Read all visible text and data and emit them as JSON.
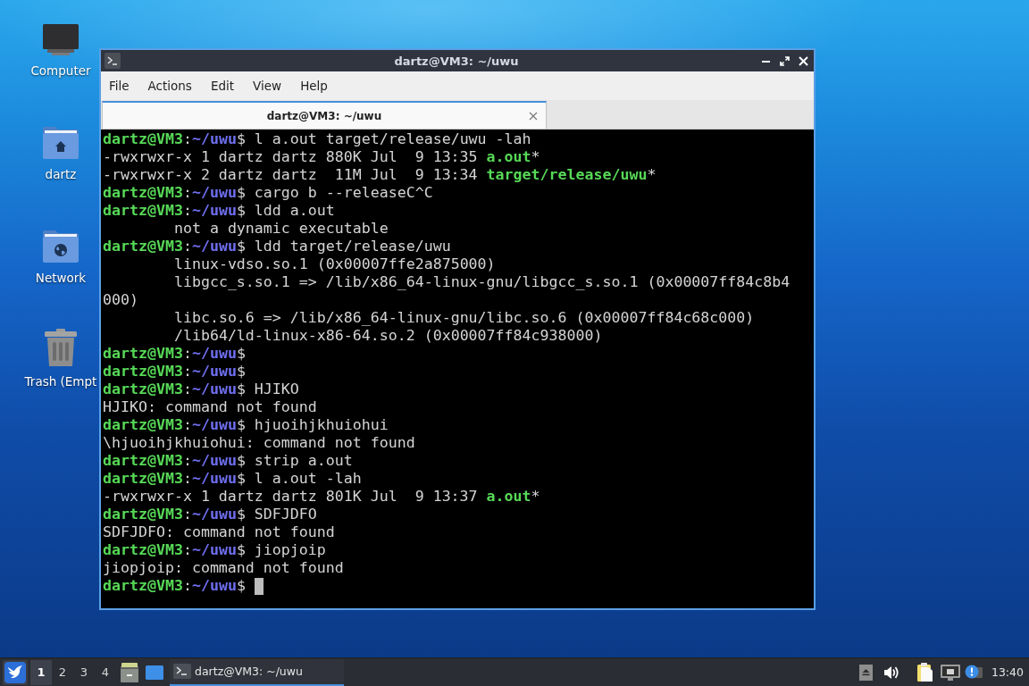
{
  "desktop_icons": [
    {
      "label": "Computer",
      "kind": "computer"
    },
    {
      "label": "dartz",
      "kind": "home"
    },
    {
      "label": "Network",
      "kind": "network"
    },
    {
      "label": "Trash (Empt",
      "kind": "trash"
    }
  ],
  "window": {
    "title": "dartz@VM3: ~/uwu",
    "focused": true
  },
  "menu": [
    "File",
    "Actions",
    "Edit",
    "View",
    "Help"
  ],
  "tabs": [
    {
      "label": "dartz@VM3: ~/uwu",
      "selected": true
    }
  ],
  "terminal": {
    "cursor": true,
    "lines": [
      {
        "segments": [
          {
            "text": "dartz@VM3",
            "kind": "user"
          },
          {
            "text": ":",
            "kind": "text"
          },
          {
            "text": "~/uwu",
            "kind": "path"
          },
          {
            "text": "$ l a.out target/release/uwu -lah",
            "kind": "text"
          }
        ]
      },
      {
        "segments": [
          {
            "text": "-rwxrwxr-x 1 dartz dartz 880K Jul  9 13:35 ",
            "kind": "text"
          },
          {
            "text": "a.out",
            "kind": "exec"
          },
          {
            "text": "*",
            "kind": "text"
          }
        ]
      },
      {
        "segments": [
          {
            "text": "-rwxrwxr-x 2 dartz dartz  11M Jul  9 13:34 ",
            "kind": "text"
          },
          {
            "text": "target/release/uwu",
            "kind": "exec"
          },
          {
            "text": "*",
            "kind": "text"
          }
        ]
      },
      {
        "segments": [
          {
            "text": "dartz@VM3",
            "kind": "user"
          },
          {
            "text": ":",
            "kind": "text"
          },
          {
            "text": "~/uwu",
            "kind": "path"
          },
          {
            "text": "$ cargo b --releaseC^C",
            "kind": "text"
          }
        ]
      },
      {
        "segments": [
          {
            "text": "dartz@VM3",
            "kind": "user"
          },
          {
            "text": ":",
            "kind": "text"
          },
          {
            "text": "~/uwu",
            "kind": "path"
          },
          {
            "text": "$ ldd a.out",
            "kind": "text"
          }
        ]
      },
      {
        "segments": [
          {
            "text": "        not a dynamic executable",
            "kind": "text"
          }
        ]
      },
      {
        "segments": [
          {
            "text": "dartz@VM3",
            "kind": "user"
          },
          {
            "text": ":",
            "kind": "text"
          },
          {
            "text": "~/uwu",
            "kind": "path"
          },
          {
            "text": "$ ldd target/release/uwu",
            "kind": "text"
          }
        ]
      },
      {
        "segments": [
          {
            "text": "        linux-vdso.so.1 (0x00007ffe2a875000)",
            "kind": "text"
          }
        ]
      },
      {
        "segments": [
          {
            "text": "        libgcc_s.so.1 => /lib/x86_64-linux-gnu/libgcc_s.so.1 (0x00007ff84c8b4",
            "kind": "text"
          }
        ]
      },
      {
        "segments": [
          {
            "text": "000)",
            "kind": "text"
          }
        ]
      },
      {
        "segments": [
          {
            "text": "        libc.so.6 => /lib/x86_64-linux-gnu/libc.so.6 (0x00007ff84c68c000)",
            "kind": "text"
          }
        ]
      },
      {
        "segments": [
          {
            "text": "        /lib64/ld-linux-x86-64.so.2 (0x00007ff84c938000)",
            "kind": "text"
          }
        ]
      },
      {
        "segments": [
          {
            "text": "dartz@VM3",
            "kind": "user"
          },
          {
            "text": ":",
            "kind": "text"
          },
          {
            "text": "~/uwu",
            "kind": "path"
          },
          {
            "text": "$",
            "kind": "text"
          }
        ]
      },
      {
        "segments": [
          {
            "text": "dartz@VM3",
            "kind": "user"
          },
          {
            "text": ":",
            "kind": "text"
          },
          {
            "text": "~/uwu",
            "kind": "path"
          },
          {
            "text": "$",
            "kind": "text"
          }
        ]
      },
      {
        "segments": [
          {
            "text": "dartz@VM3",
            "kind": "user"
          },
          {
            "text": ":",
            "kind": "text"
          },
          {
            "text": "~/uwu",
            "kind": "path"
          },
          {
            "text": "$ HJIKO",
            "kind": "text"
          }
        ]
      },
      {
        "segments": [
          {
            "text": "HJIKO: command not found",
            "kind": "text"
          }
        ]
      },
      {
        "segments": [
          {
            "text": "dartz@VM3",
            "kind": "user"
          },
          {
            "text": ":",
            "kind": "text"
          },
          {
            "text": "~/uwu",
            "kind": "path"
          },
          {
            "text": "$ hjuoihjkhuiohui",
            "kind": "text"
          }
        ]
      },
      {
        "segments": [
          {
            "text": "\\hjuoihjkhuiohui: command not found",
            "kind": "text"
          }
        ]
      },
      {
        "segments": [
          {
            "text": "dartz@VM3",
            "kind": "user"
          },
          {
            "text": ":",
            "kind": "text"
          },
          {
            "text": "~/uwu",
            "kind": "path"
          },
          {
            "text": "$ strip a.out",
            "kind": "text"
          }
        ]
      },
      {
        "segments": [
          {
            "text": "dartz@VM3",
            "kind": "user"
          },
          {
            "text": ":",
            "kind": "text"
          },
          {
            "text": "~/uwu",
            "kind": "path"
          },
          {
            "text": "$ l a.out -lah",
            "kind": "text"
          }
        ]
      },
      {
        "segments": [
          {
            "text": "-rwxrwxr-x 1 dartz dartz 801K Jul  9 13:37 ",
            "kind": "text"
          },
          {
            "text": "a.out",
            "kind": "exec"
          },
          {
            "text": "*",
            "kind": "text"
          }
        ]
      },
      {
        "segments": [
          {
            "text": "dartz@VM3",
            "kind": "user"
          },
          {
            "text": ":",
            "kind": "text"
          },
          {
            "text": "~/uwu",
            "kind": "path"
          },
          {
            "text": "$ SDFJDFO",
            "kind": "text"
          }
        ]
      },
      {
        "segments": [
          {
            "text": "SDFJDFO: command not found",
            "kind": "text"
          }
        ]
      },
      {
        "segments": [
          {
            "text": "dartz@VM3",
            "kind": "user"
          },
          {
            "text": ":",
            "kind": "text"
          },
          {
            "text": "~/uwu",
            "kind": "path"
          },
          {
            "text": "$ jiopjoip",
            "kind": "text"
          }
        ]
      },
      {
        "segments": [
          {
            "text": "jiopjoip: command not found",
            "kind": "text"
          }
        ]
      },
      {
        "segments": [
          {
            "text": "dartz@VM3",
            "kind": "user"
          },
          {
            "text": ":",
            "kind": "text"
          },
          {
            "text": "~/uwu",
            "kind": "path"
          },
          {
            "text": "$",
            "kind": "text"
          }
        ]
      }
    ]
  },
  "taskbar": {
    "workspaces": [
      {
        "label": "1",
        "selected": true
      },
      {
        "label": "2",
        "selected": false
      },
      {
        "label": "3",
        "selected": false
      },
      {
        "label": "4",
        "selected": false
      }
    ],
    "tasks": [
      {
        "label": "dartz@VM3: ~/uwu",
        "selected": true
      }
    ],
    "clock": "13:40"
  }
}
